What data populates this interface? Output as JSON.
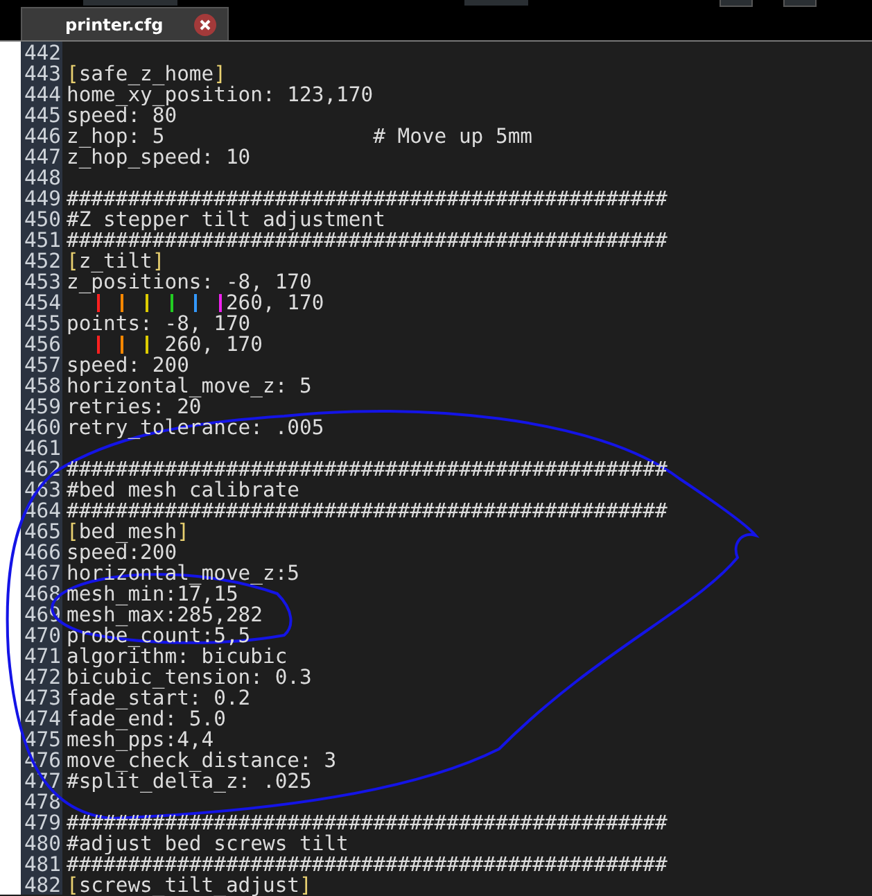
{
  "tab": {
    "title": "printer.cfg",
    "selected": true
  },
  "lines": [
    {
      "number": "442"
    },
    {
      "number": "443",
      "text": "[safe_z_home]",
      "kind": "section"
    },
    {
      "number": "444",
      "text": "home_xy_position: 123,170"
    },
    {
      "number": "445",
      "text": "speed: 80"
    },
    {
      "number": "446",
      "text": "z_hop: 5                 # Move up 5mm"
    },
    {
      "number": "447",
      "text": "z_hop_speed: 10"
    },
    {
      "number": "448"
    },
    {
      "number": "449",
      "text": "#################################################"
    },
    {
      "number": "450",
      "text": "#Z stepper tilt adjustment"
    },
    {
      "number": "451",
      "text": "#################################################"
    },
    {
      "number": "452",
      "text": "[z_tilt]",
      "kind": "section"
    },
    {
      "number": "453",
      "text": "z_positions: -8, 170"
    },
    {
      "number": "454",
      "text": "             260, 170"
    },
    {
      "number": "455",
      "text": "points: -8, 170"
    },
    {
      "number": "456",
      "text": "        260, 170"
    },
    {
      "number": "457",
      "text": "speed: 200"
    },
    {
      "number": "458",
      "text": "horizontal_move_z: 5"
    },
    {
      "number": "459",
      "text": "retries: 20"
    },
    {
      "number": "460",
      "text": "retry_tolerance: .005"
    },
    {
      "number": "461"
    },
    {
      "number": "462",
      "text": "#################################################"
    },
    {
      "number": "463",
      "text": "#bed mesh calibrate"
    },
    {
      "number": "464",
      "text": "#################################################"
    },
    {
      "number": "465",
      "text": "[bed_mesh]",
      "kind": "section"
    },
    {
      "number": "466",
      "text": "speed:200"
    },
    {
      "number": "467",
      "text": "horizontal_move_z:5"
    },
    {
      "number": "468",
      "text": "mesh_min:17,15"
    },
    {
      "number": "469",
      "text": "mesh_max:285,282"
    },
    {
      "number": "470",
      "text": "probe_count:5,5"
    },
    {
      "number": "471",
      "text": "algorithm: bicubic"
    },
    {
      "number": "472",
      "text": "bicubic_tension: 0.3"
    },
    {
      "number": "473",
      "text": "fade_start: 0.2"
    },
    {
      "number": "474",
      "text": "fade_end: 5.0"
    },
    {
      "number": "475",
      "text": "mesh_pps:4,4"
    },
    {
      "number": "476",
      "text": "move_check_distance: 3"
    },
    {
      "number": "477",
      "text": "#split_delta_z: .025"
    },
    {
      "number": "478"
    },
    {
      "number": "479",
      "text": "#################################################"
    },
    {
      "number": "480",
      "text": "#adjust bed screws tilt"
    },
    {
      "number": "481",
      "text": "#################################################"
    },
    {
      "number": "482",
      "text": "[screws_tilt_adjust]",
      "kind": "section"
    }
  ]
}
